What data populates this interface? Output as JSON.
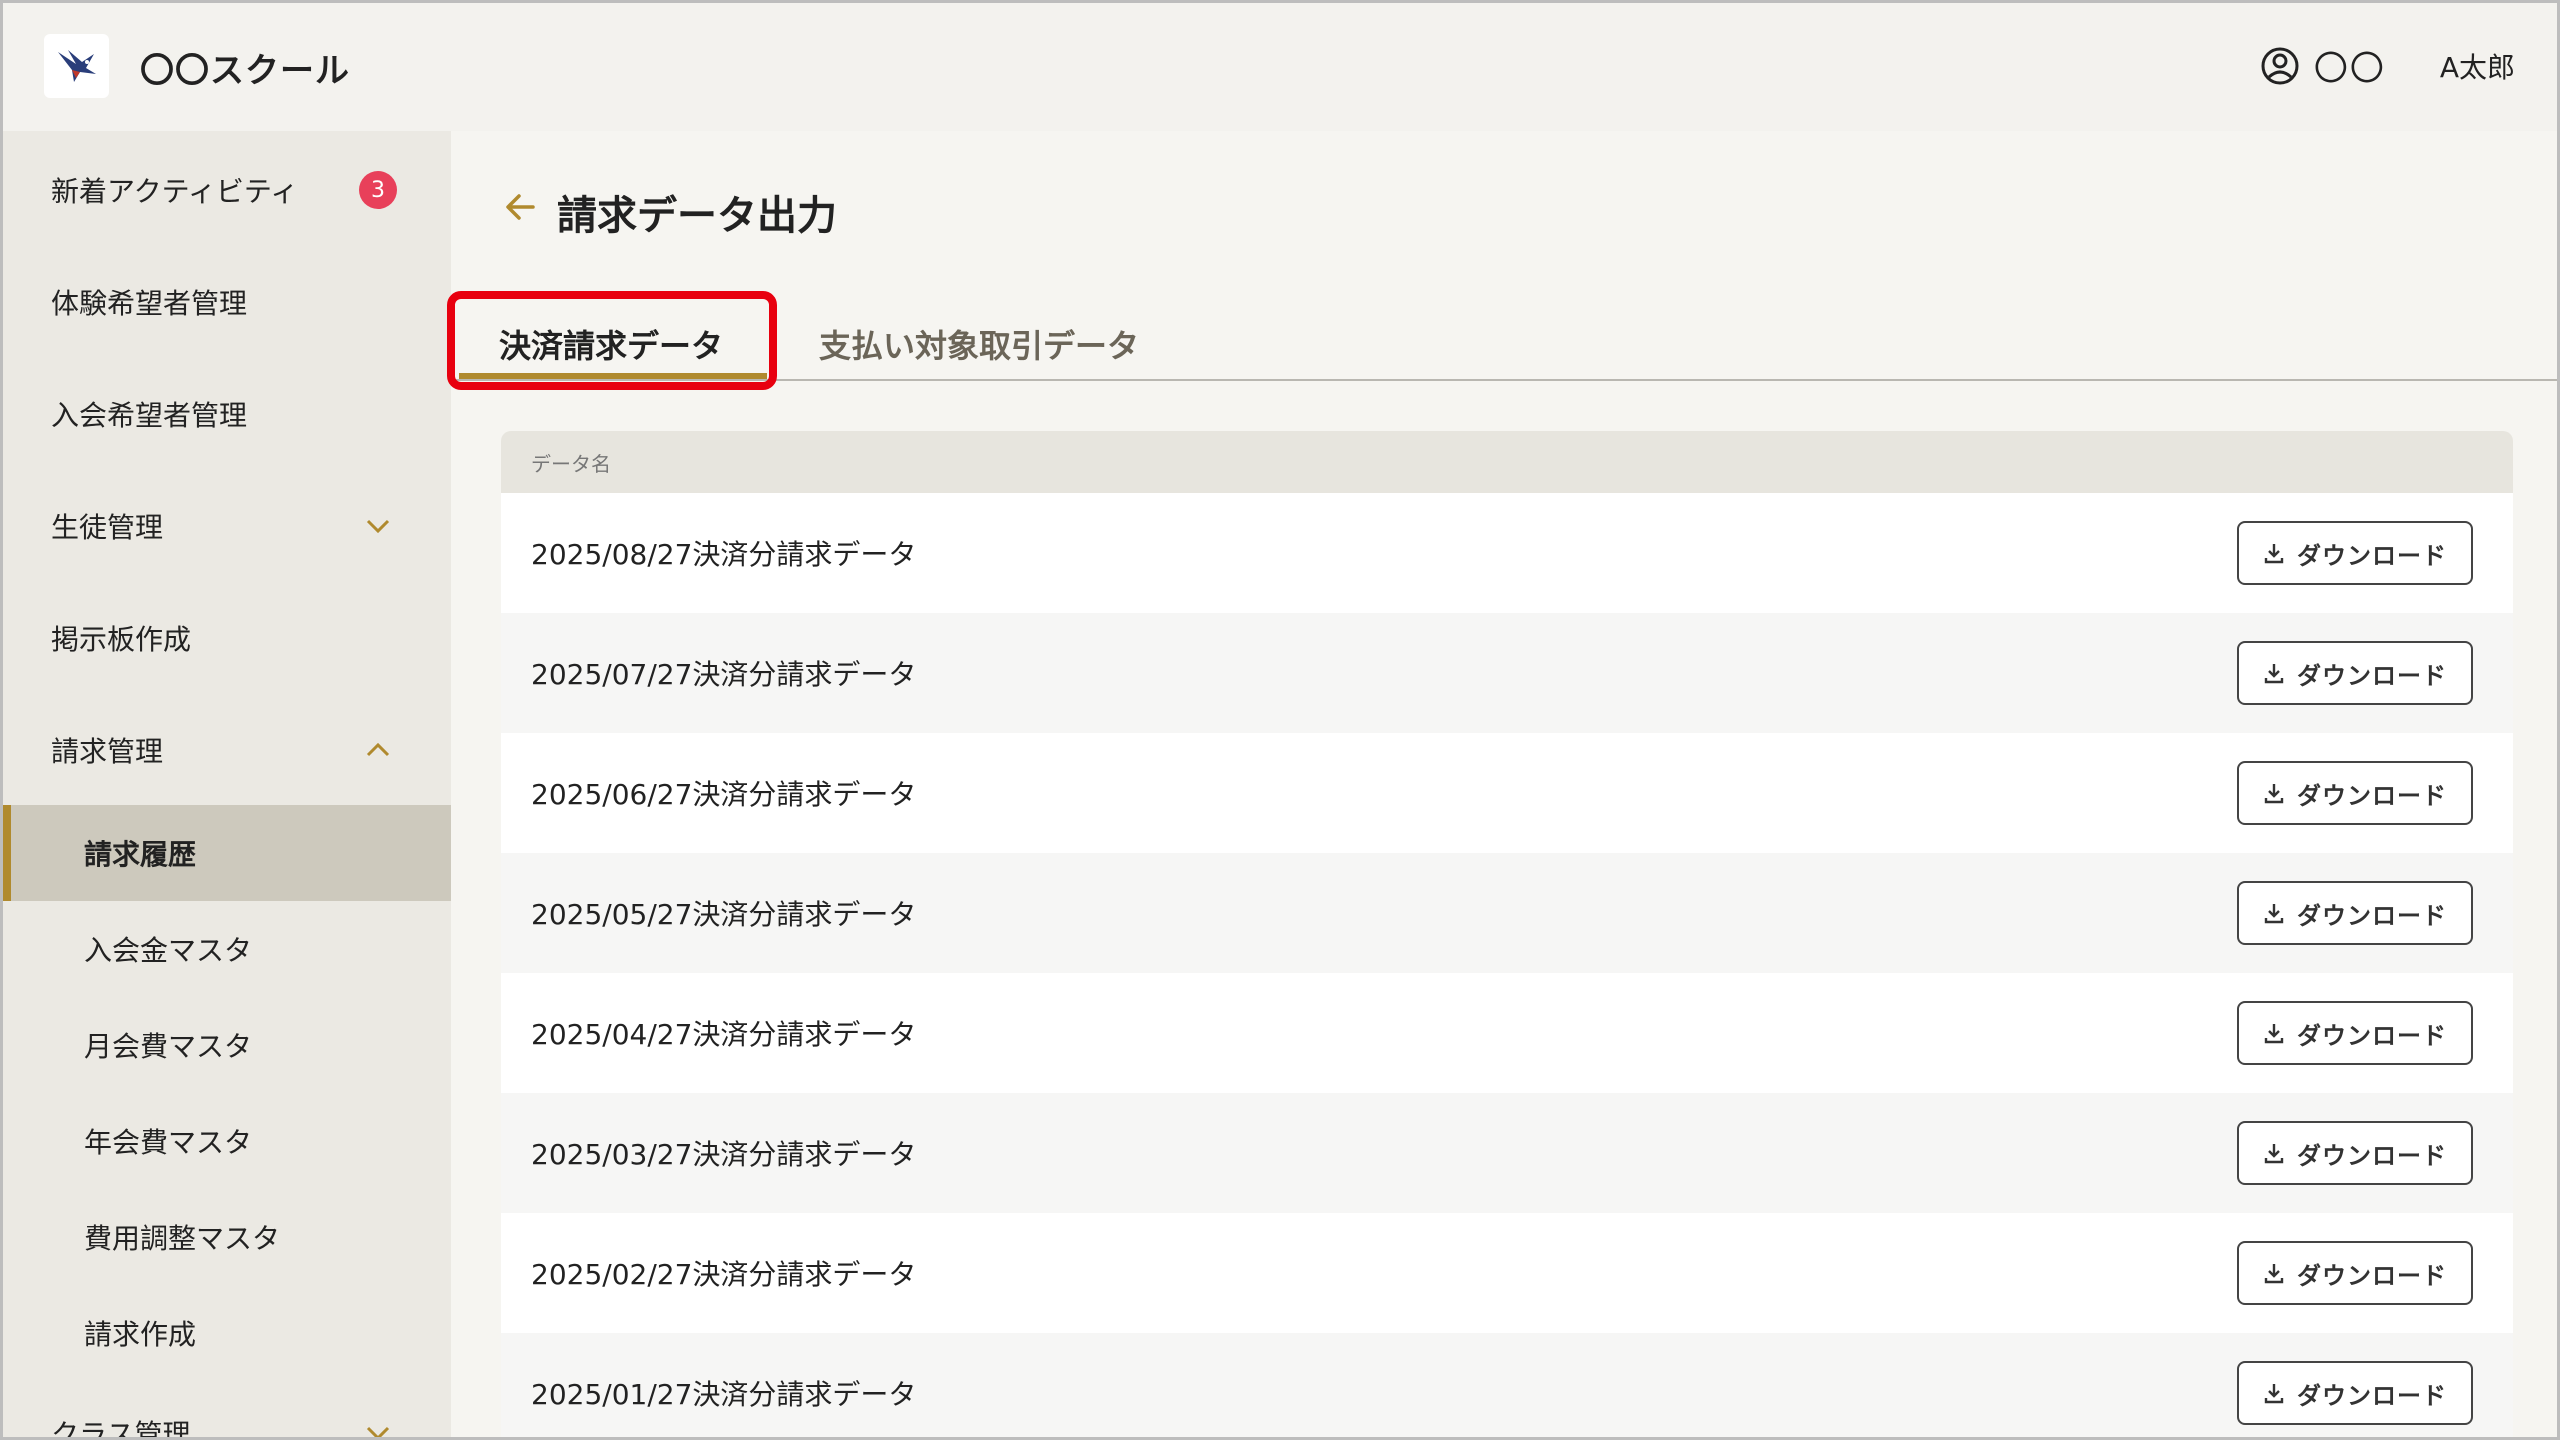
{
  "header": {
    "school_name": "〇〇スクール",
    "user_org": "〇〇",
    "user_name": "A太郎"
  },
  "sidebar": {
    "items": [
      {
        "label": "新着アクティビティ",
        "badge": "3"
      },
      {
        "label": "体験希望者管理"
      },
      {
        "label": "入会希望者管理"
      },
      {
        "label": "生徒管理"
      },
      {
        "label": "掲示板作成"
      },
      {
        "label": "請求管理"
      },
      {
        "label": "請求履歴"
      },
      {
        "label": "入会金マスタ"
      },
      {
        "label": "月会費マスタ"
      },
      {
        "label": "年会費マスタ"
      },
      {
        "label": "費用調整マスタ"
      },
      {
        "label": "請求作成"
      },
      {
        "label": "クラス管理"
      }
    ]
  },
  "main": {
    "title": "請求データ出力",
    "tabs": [
      {
        "label": "決済請求データ",
        "active": true
      },
      {
        "label": "支払い対象取引データ",
        "active": false
      }
    ],
    "table": {
      "column_header": "データ名",
      "download_label": "ダウンロード",
      "rows": [
        "2025/08/27決済分請求データ",
        "2025/07/27決済分請求データ",
        "2025/06/27決済分請求データ",
        "2025/05/27決済分請求データ",
        "2025/04/27決済分請求データ",
        "2025/03/27決済分請求データ",
        "2025/02/27決済分請求データ",
        "2025/01/27決済分請求データ"
      ]
    }
  },
  "colors": {
    "accent": "#b08a2e",
    "badge": "#e8405a",
    "highlight": "#e8000f"
  }
}
